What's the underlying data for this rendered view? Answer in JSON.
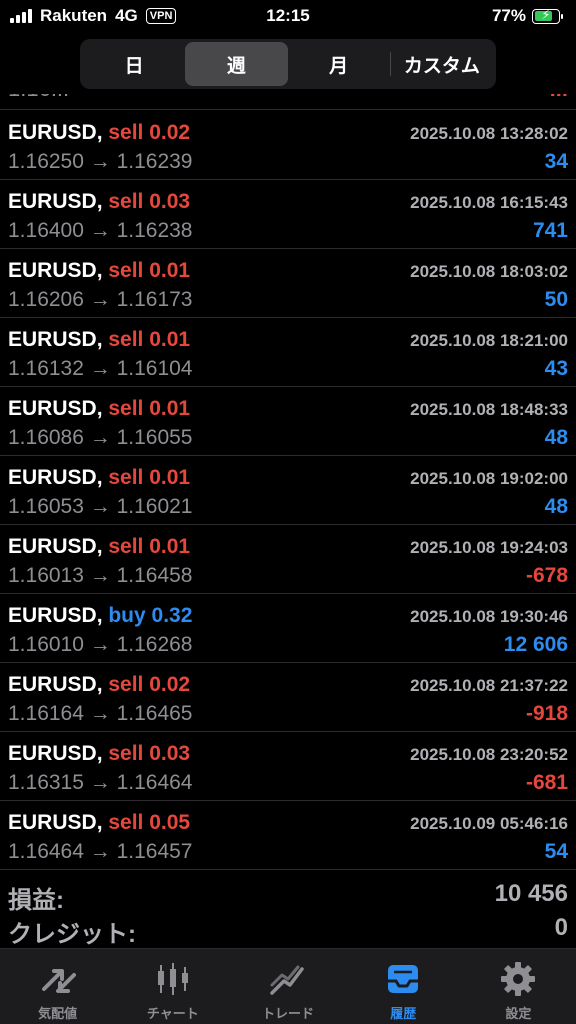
{
  "status_bar": {
    "carrier": "Rakuten",
    "network": "4G",
    "vpn": "VPN",
    "time": "12:15",
    "battery": "77%"
  },
  "period_tabs": [
    {
      "label": "日",
      "active": false
    },
    {
      "label": "週",
      "active": true
    },
    {
      "label": "月",
      "active": false
    },
    {
      "label": "カスタム",
      "active": false
    }
  ],
  "partial_row": {
    "prices": "1.16...",
    "profit": "..."
  },
  "trades": [
    {
      "symbol": "EURUSD",
      "side": "sell",
      "side_label": "sell 0.02",
      "time": "2025.10.08 13:28:02",
      "prices": "1.16250 → 1.16239",
      "profit": "34",
      "profit_sign": "pos"
    },
    {
      "symbol": "EURUSD",
      "side": "sell",
      "side_label": "sell 0.03",
      "time": "2025.10.08 16:15:43",
      "prices": "1.16400 → 1.16238",
      "profit": "741",
      "profit_sign": "pos"
    },
    {
      "symbol": "EURUSD",
      "side": "sell",
      "side_label": "sell 0.01",
      "time": "2025.10.08 18:03:02",
      "prices": "1.16206 → 1.16173",
      "profit": "50",
      "profit_sign": "pos"
    },
    {
      "symbol": "EURUSD",
      "side": "sell",
      "side_label": "sell 0.01",
      "time": "2025.10.08 18:21:00",
      "prices": "1.16132 → 1.16104",
      "profit": "43",
      "profit_sign": "pos"
    },
    {
      "symbol": "EURUSD",
      "side": "sell",
      "side_label": "sell 0.01",
      "time": "2025.10.08 18:48:33",
      "prices": "1.16086 → 1.16055",
      "profit": "48",
      "profit_sign": "pos"
    },
    {
      "symbol": "EURUSD",
      "side": "sell",
      "side_label": "sell 0.01",
      "time": "2025.10.08 19:02:00",
      "prices": "1.16053 → 1.16021",
      "profit": "48",
      "profit_sign": "pos"
    },
    {
      "symbol": "EURUSD",
      "side": "sell",
      "side_label": "sell 0.01",
      "time": "2025.10.08 19:24:03",
      "prices": "1.16013 → 1.16458",
      "profit": "-678",
      "profit_sign": "neg"
    },
    {
      "symbol": "EURUSD",
      "side": "buy",
      "side_label": "buy 0.32",
      "time": "2025.10.08 19:30:46",
      "prices": "1.16010 → 1.16268",
      "profit": "12 606",
      "profit_sign": "pos"
    },
    {
      "symbol": "EURUSD",
      "side": "sell",
      "side_label": "sell 0.02",
      "time": "2025.10.08 21:37:22",
      "prices": "1.16164 → 1.16465",
      "profit": "-918",
      "profit_sign": "neg"
    },
    {
      "symbol": "EURUSD",
      "side": "sell",
      "side_label": "sell 0.03",
      "time": "2025.10.08 23:20:52",
      "prices": "1.16315 → 1.16464",
      "profit": "-681",
      "profit_sign": "neg"
    },
    {
      "symbol": "EURUSD",
      "side": "sell",
      "side_label": "sell 0.05",
      "time": "2025.10.09 05:46:16",
      "prices": "1.16464 → 1.16457",
      "profit": "54",
      "profit_sign": "pos"
    }
  ],
  "summary": {
    "pl_label": "損益:",
    "pl_value": "10 456",
    "credit_label": "クレジット:",
    "credit_value": "0"
  },
  "tab_bar": [
    {
      "label": "気配値",
      "icon": "quotes-arrows-icon",
      "active": false
    },
    {
      "label": "チャート",
      "icon": "candlestick-icon",
      "active": false
    },
    {
      "label": "トレード",
      "icon": "trade-trend-icon",
      "active": false
    },
    {
      "label": "履歴",
      "icon": "history-inbox-icon",
      "active": true
    },
    {
      "label": "設定",
      "icon": "gear-icon",
      "active": false
    }
  ],
  "colors": {
    "sell": "#e5473d",
    "buy": "#2d8cf0",
    "positive": "#2d8cf0",
    "negative": "#e5473d",
    "active_tab": "#2d8cf0",
    "battery": "#34c759"
  }
}
